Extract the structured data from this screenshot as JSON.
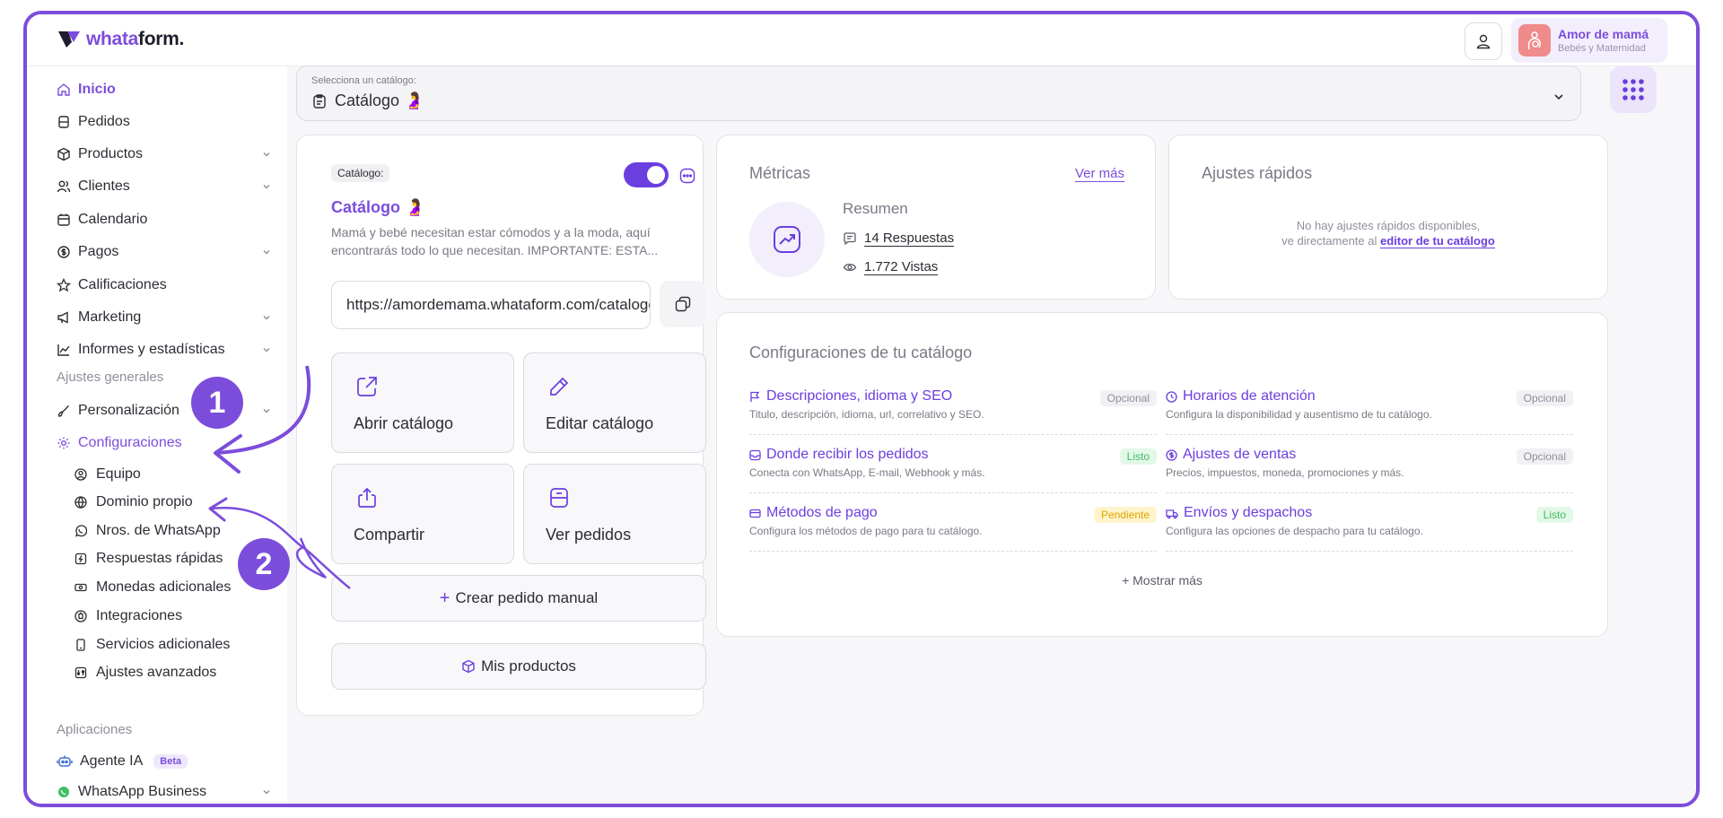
{
  "header": {
    "logo_prefix": "whata",
    "logo_suffix": "form.",
    "store_name": "Amor de mamá",
    "store_category": "Bebés y Maternidad"
  },
  "sidebar": {
    "items": [
      {
        "label": "Inicio"
      },
      {
        "label": "Pedidos"
      },
      {
        "label": "Productos"
      },
      {
        "label": "Clientes"
      },
      {
        "label": "Calendario"
      },
      {
        "label": "Pagos"
      },
      {
        "label": "Calificaciones"
      },
      {
        "label": "Marketing"
      },
      {
        "label": "Informes y estadísticas"
      }
    ],
    "section_general": "Ajustes generales",
    "personalizacion": "Personalización",
    "configuraciones": "Configuraciones",
    "sub_items": [
      {
        "label": "Equipo"
      },
      {
        "label": "Dominio propio"
      },
      {
        "label": "Nros. de WhatsApp"
      },
      {
        "label": "Respuestas rápidas"
      },
      {
        "label": "Monedas adicionales"
      },
      {
        "label": "Integraciones"
      },
      {
        "label": "Servicios adicionales"
      },
      {
        "label": "Ajustes avanzados"
      }
    ],
    "section_apps": "Aplicaciones",
    "apps": [
      {
        "label": "Agente IA",
        "badge": "Beta"
      },
      {
        "label": "WhatsApp Business"
      }
    ]
  },
  "catalog_select": {
    "label": "Selecciona un catálogo:",
    "value": "Catálogo 🤰"
  },
  "catalog_card": {
    "tag": "Catálogo:",
    "title": "Catálogo 🤰",
    "description": "Mamá y bebé necesitan estar cómodos y a la moda, aquí encontrarás todo lo que necesitan. IMPORTANTE: ESTA...",
    "url": "https://amordemama.whataform.com/catalogo",
    "toggle_on": true,
    "actions": {
      "open": "Abrir catálogo",
      "edit": "Editar catálogo",
      "share": "Compartir",
      "orders": "Ver pedidos"
    },
    "manual_order_plus": "+",
    "manual_order": "Crear pedido manual",
    "products": "Mis productos"
  },
  "metrics": {
    "title": "Métricas",
    "see_more": "Ver más",
    "summary": "Resumen",
    "responses": "14 Respuestas",
    "views": "1.772 Vistas"
  },
  "quick_settings": {
    "title": "Ajustes rápidos",
    "line1": "No hay ajustes rápidos disponibles,",
    "line2": "ve directamente al ",
    "link": "editor de tu catálogo"
  },
  "config": {
    "title": "Configuraciones de tu catálogo",
    "items": [
      {
        "title": "Descripciones, idioma y SEO",
        "desc": "Titulo, descripción, idioma, url, correlativo y SEO.",
        "badge": "Opcional"
      },
      {
        "title": "Horarios de atención",
        "desc": "Configura la disponibilidad y ausentismo de tu catálogo.",
        "badge": "Opcional"
      },
      {
        "title": "Donde recibir los pedidos",
        "desc": "Conecta con WhatsApp, E-mail, Webhook y más.",
        "badge": "Listo"
      },
      {
        "title": "Ajustes de ventas",
        "desc": "Precios, impuestos, moneda, promociones y más.",
        "badge": "Opcional"
      },
      {
        "title": "Métodos de pago",
        "desc": "Configura los métodos de pago para tu catálogo.",
        "badge": "Pendiente"
      },
      {
        "title": "Envíos y despachos",
        "desc": "Configura las opciones de despacho para tu catálogo.",
        "badge": "Listo"
      }
    ],
    "show_more": "+  Mostrar más"
  },
  "annotations": {
    "step1": "1",
    "step2": "2"
  },
  "colors": {
    "accent": "#7c4ddb",
    "frame": "#7c4ddb",
    "ok": "#3fbf63",
    "pending": "#e3a300"
  }
}
